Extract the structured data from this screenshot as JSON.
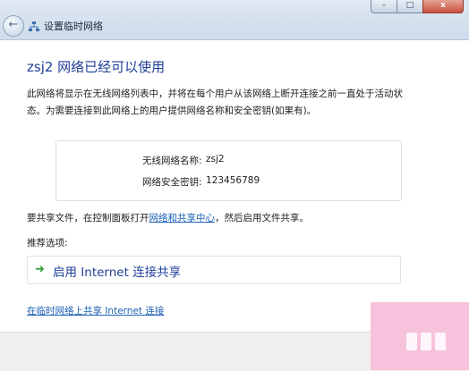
{
  "window": {
    "title": "设置临时网络",
    "controls": {
      "minimize": "–",
      "maximize": "□",
      "close": "x"
    }
  },
  "content": {
    "heading": "zsj2 网络已经可以使用",
    "description": "此网络将显示在无线网络列表中，并将在每个用户从该网络上断开连接之前一直处于活动状态。为需要连接到此网络上的用户提供网络名称和安全密钥(如果有)。",
    "network_info": {
      "name_label": "无线网络名称:",
      "name_value": "zsj2",
      "key_label": "网络安全密钥:",
      "key_value": "123456789"
    },
    "share": {
      "prefix": "要共享文件，在控制面板打开",
      "link": "网络和共享中心",
      "suffix": "，然后启用文件共享。"
    },
    "recommended_label": "推荐选项:",
    "option_label": "启用 Internet 连接共享",
    "bottom_link": "在临时网络上共享 Internet 连接"
  },
  "icons": {
    "back": "back-arrow-icon",
    "network": "network-icon",
    "option_arrow": "green-arrow-icon"
  },
  "colors": {
    "heading": "#1f3f99",
    "link": "#1b5fb4",
    "option_arrow": "#2e9a3a",
    "watermark_bg": "#f7c3dc"
  }
}
